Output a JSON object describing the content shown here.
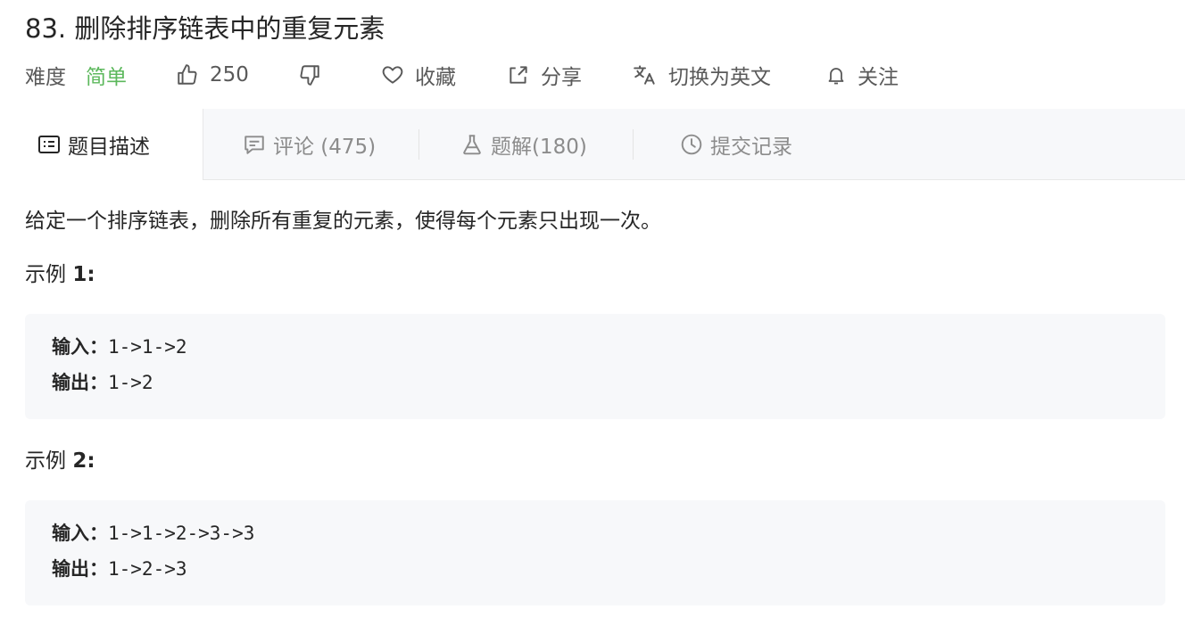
{
  "problem": {
    "title": "83. 删除排序链表中的重复元素",
    "difficulty_label": "难度",
    "difficulty_value": "简单",
    "likes": "250",
    "favorite_label": "收藏",
    "share_label": "分享",
    "translate_label": "切换为英文",
    "follow_label": "关注"
  },
  "tabs": [
    {
      "label": "题目描述",
      "icon": "description-icon",
      "active": true
    },
    {
      "label": "评论 (475)",
      "icon": "comment-icon",
      "active": false
    },
    {
      "label": "题解(180)",
      "icon": "flask-icon",
      "active": false
    },
    {
      "label": "提交记录",
      "icon": "clock-icon",
      "active": false
    }
  ],
  "content": {
    "description": "给定一个排序链表，删除所有重复的元素，使得每个元素只出现一次。",
    "examples": [
      {
        "title_prefix": "示例",
        "title_number": "1:",
        "input_label": "输入：",
        "input_value": "1->1->2",
        "output_label": "输出：",
        "output_value": "1->2"
      },
      {
        "title_prefix": "示例",
        "title_number": "2:",
        "input_label": "输入：",
        "input_value": "1->1->2->3->3",
        "output_label": "输出：",
        "output_value": "1->2->3"
      }
    ]
  },
  "colors": {
    "difficulty_easy": "#5cb85c",
    "tab_bar_bg": "#f7f8fa",
    "code_bg": "#f7f8fa"
  }
}
